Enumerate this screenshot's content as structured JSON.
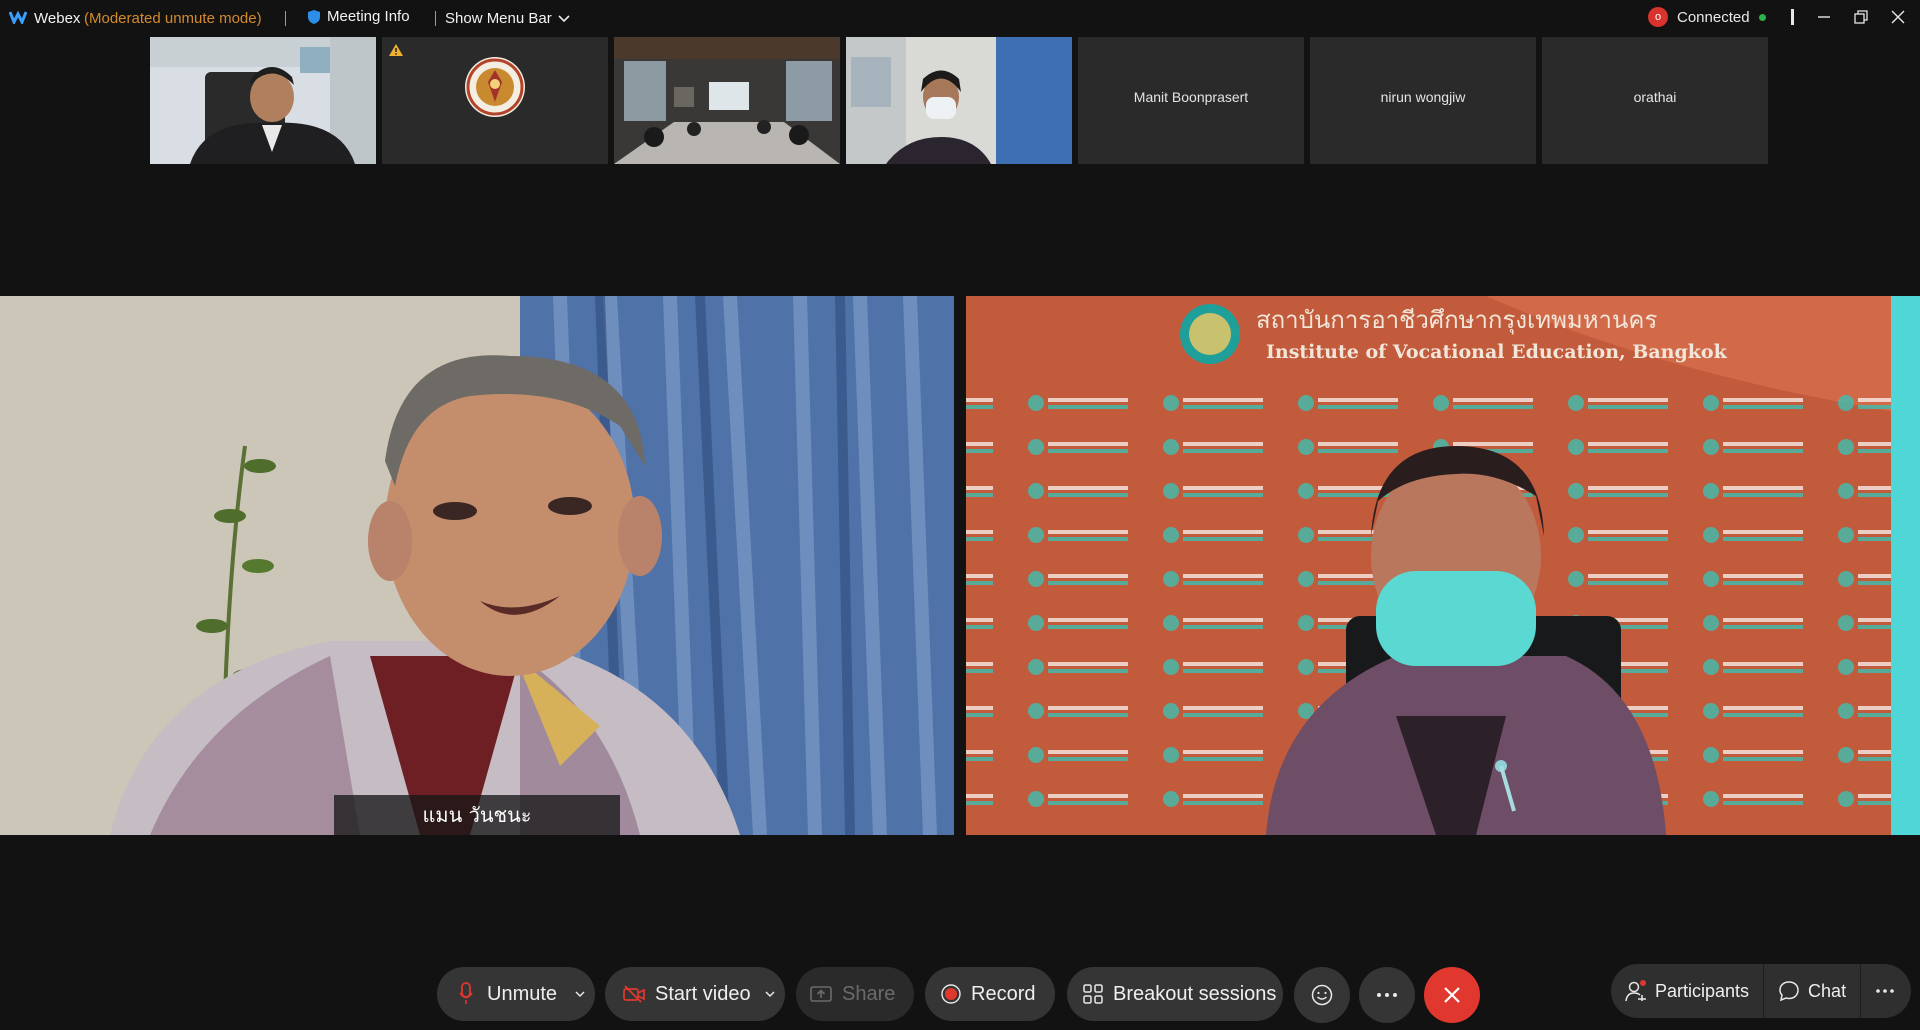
{
  "titlebar": {
    "app_name": "Webex",
    "mode": "(Moderated unmute mode)",
    "meeting_info": "Meeting Info",
    "show_menu_bar": "Show Menu Bar",
    "connection_badge": "o",
    "connection_status": "Connected"
  },
  "thumbnails": [
    {
      "kind": "video",
      "name": ""
    },
    {
      "kind": "video",
      "name": ""
    },
    {
      "kind": "video",
      "name": ""
    },
    {
      "kind": "video",
      "name": ""
    },
    {
      "kind": "name",
      "name": "Manit Boonprasert"
    },
    {
      "kind": "name",
      "name": "nirun wongjiw"
    },
    {
      "kind": "name",
      "name": "orathai"
    }
  ],
  "main": {
    "left_name": "แมน วันชนะ",
    "right_banner_thai": "สถาบันการอาชีวศึกษากรุงเทพมหานคร",
    "right_banner_en": "Institute of Vocational Education, Bangkok"
  },
  "controls": {
    "unmute": "Unmute",
    "start_video": "Start video",
    "share": "Share",
    "record": "Record",
    "breakout": "Breakout sessions",
    "participants": "Participants",
    "chat": "Chat"
  },
  "colors": {
    "accent_mode": "#d48a2c",
    "end_call": "#e0382e",
    "record_dot": "#e0382e",
    "connected_dot": "#2bb24a"
  }
}
